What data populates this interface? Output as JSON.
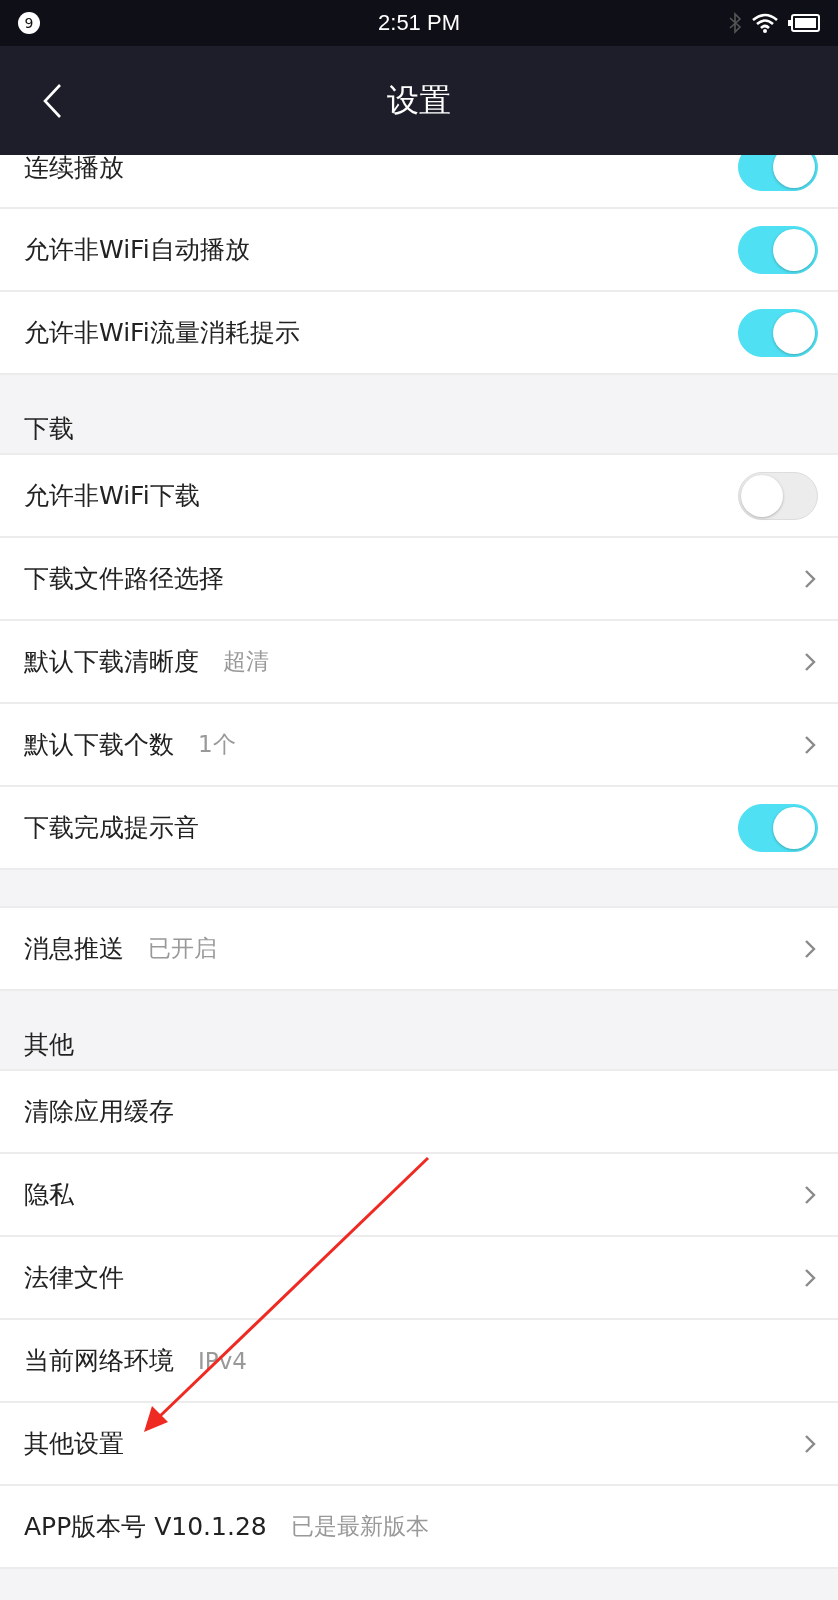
{
  "status_bar": {
    "notification_count": "9",
    "time": "2:51 PM"
  },
  "nav": {
    "title": "设置"
  },
  "sections": [
    {
      "rows": [
        {
          "kind": "toggle",
          "label": "连续播放",
          "on": true
        },
        {
          "kind": "toggle",
          "label": "允许非WiFi自动播放",
          "on": true
        },
        {
          "kind": "toggle",
          "label": "允许非WiFi流量消耗提示",
          "on": true
        }
      ]
    },
    {
      "header": "下载",
      "rows": [
        {
          "kind": "toggle",
          "label": "允许非WiFi下载",
          "on": false
        },
        {
          "kind": "link",
          "label": "下载文件路径选择"
        },
        {
          "kind": "link",
          "label": "默认下载清晰度",
          "value": "超清"
        },
        {
          "kind": "link",
          "label": "默认下载个数",
          "value": "1个"
        },
        {
          "kind": "toggle",
          "label": "下载完成提示音",
          "on": true
        }
      ]
    },
    {
      "rows": [
        {
          "kind": "link",
          "label": "消息推送",
          "value": "已开启"
        }
      ]
    },
    {
      "header": "其他",
      "rows": [
        {
          "kind": "info",
          "label": "清除应用缓存"
        },
        {
          "kind": "link",
          "label": "隐私"
        },
        {
          "kind": "link",
          "label": "法律文件"
        },
        {
          "kind": "info",
          "label": "当前网络环境",
          "value": "IPv4"
        },
        {
          "kind": "link",
          "label": "其他设置"
        },
        {
          "kind": "info",
          "label": "APP版本号 V10.1.28",
          "value": "已是最新版本"
        }
      ]
    }
  ]
}
